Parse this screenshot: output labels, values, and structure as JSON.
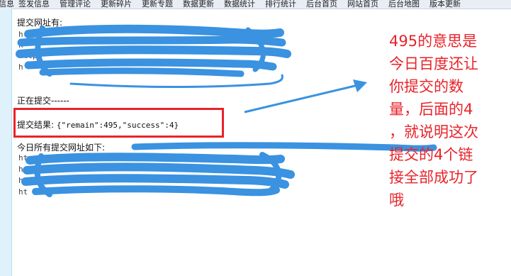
{
  "nav": {
    "items": [
      "信息",
      "签发信息",
      "管理评论",
      "更新碎片",
      "更新专题",
      "数据更新",
      "数据统计",
      "排行统计",
      "后台首页",
      "网站首页",
      "后台地图",
      "版本更新"
    ]
  },
  "content": {
    "submitted_header": "提交网址有:",
    "urls_top": [
      "h",
      "h",
      "http:",
      "h"
    ],
    "submitting": "正在提交------",
    "result_label": "提交结果:",
    "result_value": "{\"remain\":495,\"success\":4}",
    "all_urls_label": "今日所有提交网址如下:",
    "urls_bottom": [
      "ht",
      "h",
      "ht",
      "ht"
    ]
  },
  "annotation": {
    "lines": [
      "495的意思是",
      "今日百度还让",
      "你提交的数",
      "量，后面的4",
      "，就说明这次",
      "提交的4个链",
      "接全部成功了",
      "哦"
    ],
    "color": "#e9232a"
  },
  "colors": {
    "scribble": "#3a92e0",
    "arrow": "#3a92e0",
    "box": "#e9232a"
  }
}
